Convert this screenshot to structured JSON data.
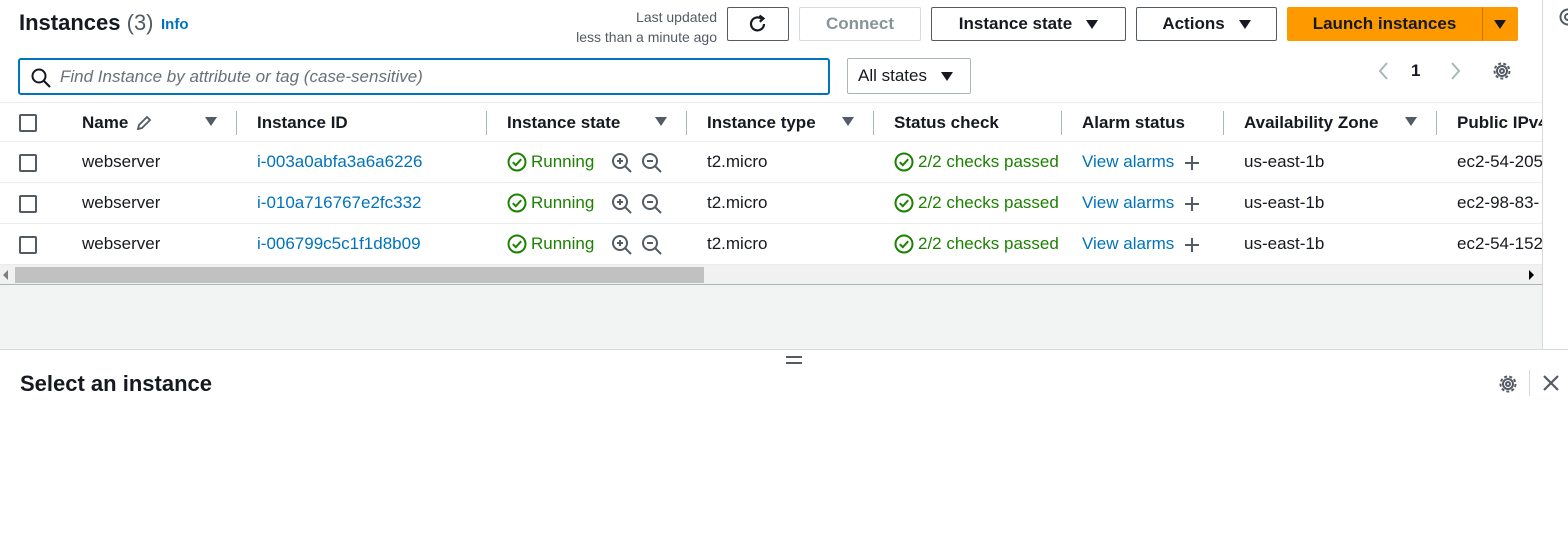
{
  "header": {
    "title": "Instances",
    "count": "(3)",
    "info": "Info",
    "last_updated_line1": "Last updated",
    "last_updated_line2": "less than a minute ago"
  },
  "toolbar": {
    "connect": "Connect",
    "instance_state": "Instance state",
    "actions": "Actions",
    "launch": "Launch instances"
  },
  "search": {
    "placeholder": "Find Instance by attribute or tag (case-sensitive)",
    "value": ""
  },
  "filter": {
    "selected": "All states"
  },
  "pagination": {
    "current_page": "1"
  },
  "columns": {
    "name": "Name",
    "instance_id": "Instance ID",
    "instance_state": "Instance state",
    "instance_type": "Instance type",
    "status_check": "Status check",
    "alarm_status": "Alarm status",
    "availability_zone": "Availability Zone",
    "public_ipv4": "Public IPv4"
  },
  "rows": [
    {
      "name": "webserver",
      "instance_id": "i-003a0abfa3a6a6226",
      "state": "Running",
      "type": "t2.micro",
      "status": "2/2 checks passed",
      "alarm": "View alarms",
      "zone": "us-east-1b",
      "dns": "ec2-54-205"
    },
    {
      "name": "webserver",
      "instance_id": "i-010a716767e2fc332",
      "state": "Running",
      "type": "t2.micro",
      "status": "2/2 checks passed",
      "alarm": "View alarms",
      "zone": "us-east-1b",
      "dns": "ec2-98-83-"
    },
    {
      "name": "webserver",
      "instance_id": "i-006799c5c1f1d8b09",
      "state": "Running",
      "type": "t2.micro",
      "status": "2/2 checks passed",
      "alarm": "View alarms",
      "zone": "us-east-1b",
      "dns": "ec2-54-152"
    }
  ],
  "details_panel": {
    "title": "Select an instance"
  },
  "colors": {
    "accent": "#0073bb",
    "launch": "#ff9900",
    "running": "#1d8102"
  }
}
